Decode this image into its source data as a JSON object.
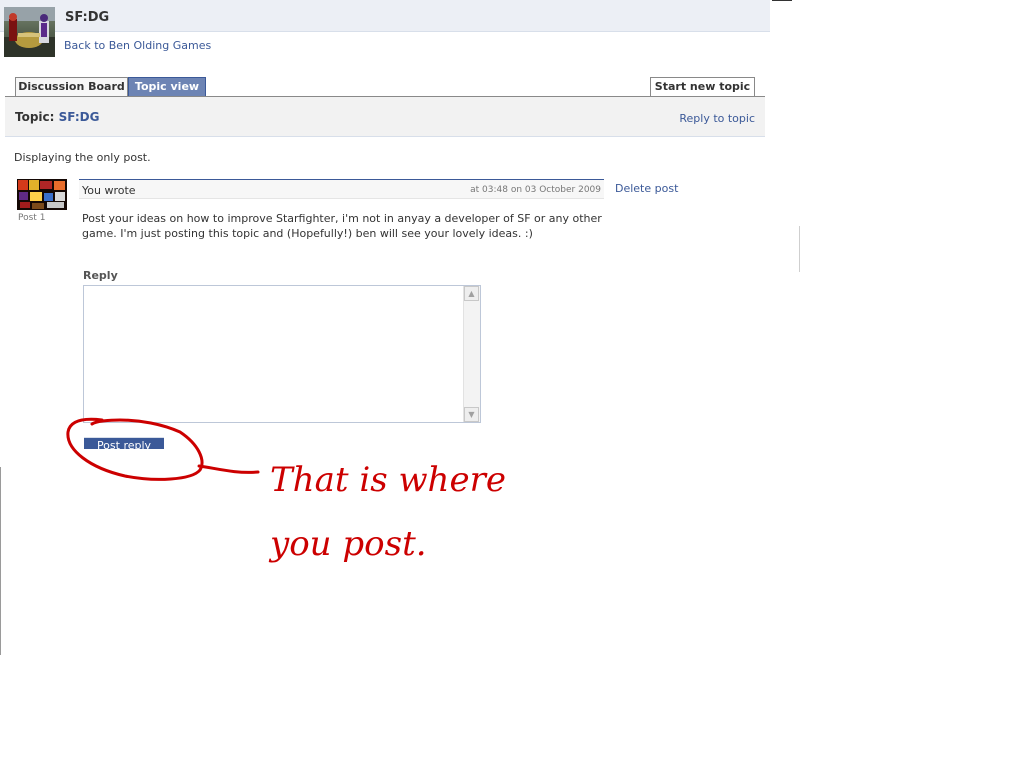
{
  "header": {
    "title": "SF:DG",
    "back_link": "Back to Ben Olding Games"
  },
  "tabs": {
    "discussion_board": "Discussion Board",
    "topic_view": "Topic view",
    "start_new_topic": "Start new topic"
  },
  "topic": {
    "prefix": "Topic:",
    "name": "SF:DG",
    "reply_link": "Reply to topic",
    "displaying": "Displaying the only post."
  },
  "post": {
    "number": "Post 1",
    "author_line": "You wrote",
    "timestamp": "at 03:48 on 03 October 2009",
    "delete_link": "Delete post",
    "body": "Post your ideas on how to improve Starfighter, i'm not in anyay a developer of SF or any other game. I'm just posting this topic and (Hopefully!) ben will see your lovely ideas. :)"
  },
  "reply": {
    "label": "Reply",
    "value": "",
    "button_label": "Post reply"
  },
  "annotation": {
    "text": "That is where you post.",
    "color": "#cc0000"
  },
  "colors": {
    "brand": "#3b5998",
    "tab_active": "#6d84b4"
  },
  "icons": {
    "scroll_up": "triangle-up",
    "scroll_down": "triangle-down"
  }
}
